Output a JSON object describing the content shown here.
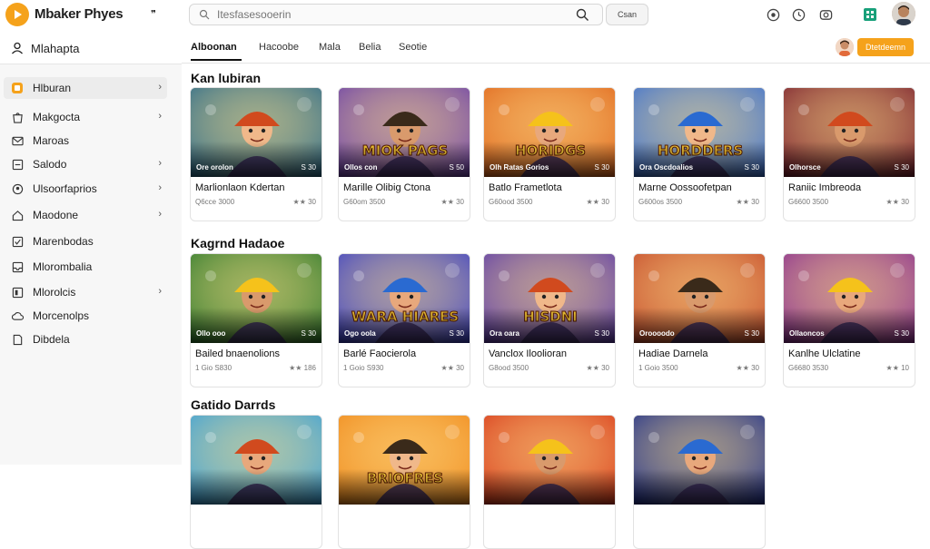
{
  "app": {
    "brand": "Mbaker Phyes",
    "search_placeholder": "Itesfasesooerin",
    "search_button": "Csan"
  },
  "sidebar": {
    "header": "Mlahapta",
    "items": [
      {
        "label": "Hlburan",
        "chevron": true,
        "active": true,
        "icon": "game-icon"
      },
      {
        "label": "Makgocta",
        "chevron": true,
        "active": false,
        "icon": "bag-icon"
      },
      {
        "label": "Maroas",
        "chevron": false,
        "active": false,
        "icon": "mail-icon"
      },
      {
        "label": "Salodo",
        "chevron": true,
        "active": false,
        "icon": "list-icon"
      },
      {
        "label": "Ulsoorfaprios",
        "chevron": true,
        "active": false,
        "icon": "badge-icon"
      },
      {
        "label": "Maodone",
        "chevron": true,
        "active": false,
        "icon": "home-icon"
      },
      {
        "label": "Marenbodas",
        "chevron": false,
        "active": false,
        "icon": "checkbox-icon"
      },
      {
        "label": "Mlorombalia",
        "chevron": false,
        "active": false,
        "icon": "inbox-icon"
      },
      {
        "label": "Mlorolcis",
        "chevron": true,
        "active": false,
        "icon": "tag-icon"
      },
      {
        "label": "Morcenolps",
        "chevron": false,
        "active": false,
        "icon": "cloud-icon"
      },
      {
        "label": "Dibdela",
        "chevron": false,
        "active": false,
        "icon": "doc-icon"
      }
    ]
  },
  "tabs": [
    {
      "label": "Alboonan",
      "active": true
    },
    {
      "label": "Hacoobe",
      "active": false
    },
    {
      "label": "Mala",
      "active": false
    },
    {
      "label": "Belia",
      "active": false
    },
    {
      "label": "Seotie",
      "active": false
    }
  ],
  "header_cta": "Dtetdeemn",
  "sections": [
    {
      "title": "Kan lubiran",
      "cards": [
        {
          "tl": "Ore orolon",
          "tr": "S 30",
          "name": "Marlionlaon Kdertan",
          "sub": "Q6cce 3000",
          "rating": "★★ 30"
        },
        {
          "tl": "Ollos con",
          "tr": "S 50",
          "name": "Marille Olibig Ctona",
          "sub": "G60om 3500",
          "rating": "★★ 30"
        },
        {
          "tl": "Olh Ratas Gorios",
          "tr": "S 30",
          "name": "Batlo Frametlota",
          "sub": "G60ood 3500",
          "rating": "★★ 30"
        },
        {
          "tl": "Ora Oscdoalios",
          "tr": "S 30",
          "name": "Marne Oossoofetpan",
          "sub": "G600os 3500",
          "rating": "★★ 30"
        },
        {
          "tl": "Olhorsce",
          "tr": "S 30",
          "name": "Raniic Imbreoda",
          "sub": "G6600 3500",
          "rating": "★★ 30"
        }
      ]
    },
    {
      "title": "Kagrnd Hadaoe",
      "cards": [
        {
          "tl": "Ollo ooo",
          "tr": "S 30",
          "name": "Bailed bnaenolions",
          "sub": "1 Gio S830",
          "rating": "★★ 186"
        },
        {
          "tl": "Ogo oola",
          "tr": "S 30",
          "name": "Barlé Faocierola",
          "sub": "1 Goio S930",
          "rating": "★★ 30"
        },
        {
          "tl": "Ora oara",
          "tr": "S 30",
          "name": "Vanclox Iloolioran",
          "sub": "G8ood 3500",
          "rating": "★★ 30"
        },
        {
          "tl": "Oroooodo",
          "tr": "S 30",
          "name": "Hadiae Darnela",
          "sub": "1 Goio 3500",
          "rating": "★★ 30"
        },
        {
          "tl": "Ollaoncos",
          "tr": "S 30",
          "name": "Kanlhe Ulclatine",
          "sub": "G6680 3530",
          "rating": "★★ 10"
        }
      ]
    },
    {
      "title": "Gatido Darrds",
      "cards": [
        {
          "tl": "",
          "tr": "",
          "name": "",
          "sub": "",
          "rating": ""
        },
        {
          "tl": "",
          "tr": "",
          "name": "",
          "sub": "",
          "rating": ""
        },
        {
          "tl": "",
          "tr": "",
          "name": "",
          "sub": "",
          "rating": ""
        },
        {
          "tl": "",
          "tr": "",
          "name": "",
          "sub": "",
          "rating": ""
        }
      ]
    }
  ],
  "thumb_text": {
    "r0c1": "MIOK PAGS",
    "r0c2": "HORIDGS",
    "r0c3": "HORDDERS",
    "r1c1": "WARA HIARES",
    "r1c2": "HISDNI",
    "r2c1": "BRIOFRES"
  },
  "colors": {
    "accent": "#f5a21b",
    "thumb_bgs": [
      [
        "#2b6a8a",
        "#6a3fa8",
        "#e0661c",
        "#3a6fd1",
        "#7a1f2e"
      ],
      [
        "#2f7a2c",
        "#3a3fc4",
        "#5b3aa8",
        "#c54a2a",
        "#8a2f8f"
      ],
      [
        "#3aa0d8",
        "#f08a1c",
        "#d83a1a",
        "#1f2f8a"
      ]
    ]
  }
}
